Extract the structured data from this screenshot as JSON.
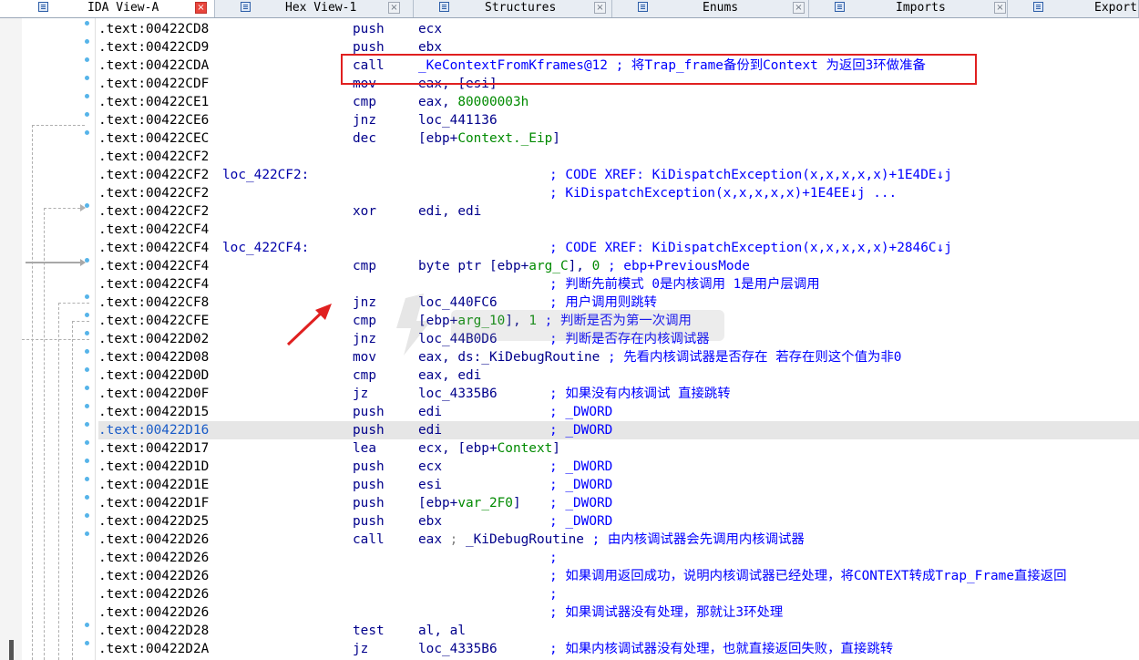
{
  "tabs": [
    {
      "label": "IDA View-A",
      "active": true,
      "icon": "listing-icon"
    },
    {
      "label": "Hex View-1",
      "active": false,
      "icon": "hex-icon"
    },
    {
      "label": "Structures",
      "active": false,
      "icon": "structures-icon"
    },
    {
      "label": "Enums",
      "active": false,
      "icon": "enums-icon"
    },
    {
      "label": "Imports",
      "active": false,
      "icon": "imports-icon"
    },
    {
      "label": "Export",
      "active": false,
      "icon": "exports-icon"
    }
  ],
  "close_glyph": "×",
  "rows": [
    {
      "addr": ".text:00422CD8",
      "label": "",
      "mnem": "push",
      "op": [
        {
          "t": "ecx"
        }
      ],
      "cmt": []
    },
    {
      "addr": ".text:00422CD9",
      "label": "",
      "mnem": "push",
      "op": [
        {
          "t": "ebx"
        }
      ],
      "cmt": []
    },
    {
      "addr": ".text:00422CDA",
      "label": "",
      "mnem": "call",
      "op": [
        {
          "t": "_KeContextFromKframes@12 ",
          "c": "cmt"
        },
        {
          "t": "; 将Trap_frame备份到Context 为返回3环做准备",
          "c": "cmt"
        }
      ],
      "cmt": []
    },
    {
      "addr": ".text:00422CDF",
      "label": "",
      "mnem": "mov",
      "op": [
        {
          "t": "eax, [esi]"
        }
      ],
      "cmt": []
    },
    {
      "addr": ".text:00422CE1",
      "label": "",
      "mnem": "cmp",
      "op": [
        {
          "t": "eax, "
        },
        {
          "t": "80000003h",
          "c": "num"
        }
      ],
      "cmt": []
    },
    {
      "addr": ".text:00422CE6",
      "label": "",
      "mnem": "jnz",
      "op": [
        {
          "t": "loc_441136"
        }
      ],
      "cmt": []
    },
    {
      "addr": ".text:00422CEC",
      "label": "",
      "mnem": "dec",
      "op": [
        {
          "t": "[ebp+"
        },
        {
          "t": "Context._Eip",
          "c": "grn"
        },
        {
          "t": "]"
        }
      ],
      "cmt": []
    },
    {
      "addr": ".text:00422CF2",
      "label": "",
      "mnem": "",
      "op": [],
      "cmt": []
    },
    {
      "addr": ".text:00422CF2",
      "label": "loc_422CF2:",
      "mnem": "",
      "op": [],
      "cmt": [
        {
          "t": "; CODE XREF: KiDispatchException(x,x,x,x,x)+1E4DE↓j"
        }
      ]
    },
    {
      "addr": ".text:00422CF2",
      "label": "",
      "mnem": "",
      "op": [],
      "cmt": [
        {
          "t": "; KiDispatchException(x,x,x,x,x)+1E4EE↓j ..."
        }
      ]
    },
    {
      "addr": ".text:00422CF2",
      "label": "",
      "mnem": "xor",
      "op": [
        {
          "t": "edi, edi"
        }
      ],
      "cmt": []
    },
    {
      "addr": ".text:00422CF4",
      "label": "",
      "mnem": "",
      "op": [],
      "cmt": []
    },
    {
      "addr": ".text:00422CF4",
      "label": "loc_422CF4:",
      "mnem": "",
      "op": [],
      "cmt": [
        {
          "t": "; CODE XREF: KiDispatchException(x,x,x,x,x)+2846C↓j"
        }
      ]
    },
    {
      "addr": ".text:00422CF4",
      "label": "",
      "mnem": "cmp",
      "op": [
        {
          "t": "byte ptr [ebp+"
        },
        {
          "t": "arg_C",
          "c": "grn"
        },
        {
          "t": "], "
        },
        {
          "t": "0",
          "c": "num"
        },
        {
          "t": " "
        },
        {
          "t": "; ebp+PreviousMode",
          "c": "cmt"
        }
      ],
      "cmt": []
    },
    {
      "addr": ".text:00422CF4",
      "label": "",
      "mnem": "",
      "op": [],
      "cmt": [
        {
          "t": "; 判断先前模式 0是内核调用 1是用户层调用"
        }
      ]
    },
    {
      "addr": ".text:00422CF8",
      "label": "",
      "mnem": "jnz",
      "op": [
        {
          "t": "loc_440FC6"
        }
      ],
      "cmt": [
        {
          "t": "; 用户调用则跳转"
        }
      ]
    },
    {
      "addr": ".text:00422CFE",
      "label": "",
      "mnem": "cmp",
      "op": [
        {
          "t": "[ebp+"
        },
        {
          "t": "arg_10",
          "c": "grn"
        },
        {
          "t": "], "
        },
        {
          "t": "1",
          "c": "num"
        },
        {
          "t": " "
        },
        {
          "t": "; 判断是否为第一次调用",
          "c": "cmt"
        }
      ],
      "cmt": []
    },
    {
      "addr": ".text:00422D02",
      "label": "",
      "mnem": "jnz",
      "op": [
        {
          "t": "loc_44B0D6"
        }
      ],
      "cmt": [
        {
          "t": "; 判断是否存在内核调试器"
        }
      ]
    },
    {
      "addr": ".text:00422D08",
      "label": "",
      "mnem": "mov",
      "op": [
        {
          "t": "eax, ds:_KiDebugRoutine "
        },
        {
          "t": "; 先看内核调试器是否存在 若存在则这个值为非0",
          "c": "cmt"
        }
      ],
      "cmt": []
    },
    {
      "addr": ".text:00422D0D",
      "label": "",
      "mnem": "cmp",
      "op": [
        {
          "t": "eax, edi"
        }
      ],
      "cmt": []
    },
    {
      "addr": ".text:00422D0F",
      "label": "",
      "mnem": "jz",
      "op": [
        {
          "t": "loc_4335B6"
        }
      ],
      "cmt": [
        {
          "t": "; 如果没有内核调试 直接跳转"
        }
      ]
    },
    {
      "addr": ".text:00422D15",
      "label": "",
      "mnem": "push",
      "op": [
        {
          "t": "edi"
        }
      ],
      "cmt": [
        {
          "t": "; _DWORD"
        }
      ]
    },
    {
      "addr": ".text:00422D16",
      "label": "",
      "mnem": "push",
      "op": [
        {
          "t": "edi"
        }
      ],
      "cmt": [
        {
          "t": "; _DWORD"
        }
      ],
      "hl": true
    },
    {
      "addr": ".text:00422D17",
      "label": "",
      "mnem": "lea",
      "op": [
        {
          "t": "ecx, [ebp+"
        },
        {
          "t": "Context",
          "c": "grn"
        },
        {
          "t": "]"
        }
      ],
      "cmt": []
    },
    {
      "addr": ".text:00422D1D",
      "label": "",
      "mnem": "push",
      "op": [
        {
          "t": "ecx"
        }
      ],
      "cmt": [
        {
          "t": "; _DWORD"
        }
      ]
    },
    {
      "addr": ".text:00422D1E",
      "label": "",
      "mnem": "push",
      "op": [
        {
          "t": "esi"
        }
      ],
      "cmt": [
        {
          "t": "; _DWORD"
        }
      ]
    },
    {
      "addr": ".text:00422D1F",
      "label": "",
      "mnem": "push",
      "op": [
        {
          "t": "[ebp+"
        },
        {
          "t": "var_2F0",
          "c": "grn"
        },
        {
          "t": "]"
        }
      ],
      "cmt": [
        {
          "t": "; _DWORD"
        }
      ]
    },
    {
      "addr": ".text:00422D25",
      "label": "",
      "mnem": "push",
      "op": [
        {
          "t": "ebx"
        }
      ],
      "cmt": [
        {
          "t": "; _DWORD"
        }
      ]
    },
    {
      "addr": ".text:00422D26",
      "label": "",
      "mnem": "call",
      "op": [
        {
          "t": "eax "
        },
        {
          "t": "; ",
          "c": "gray"
        },
        {
          "t": "_KiDebugRoutine ",
          "c": "blk"
        },
        {
          "t": "; 由内核调试器会先调用内核调试器",
          "c": "cmt"
        }
      ],
      "cmt": []
    },
    {
      "addr": ".text:00422D26",
      "label": "",
      "mnem": "",
      "op": [],
      "cmt": [
        {
          "t": ";"
        }
      ]
    },
    {
      "addr": ".text:00422D26",
      "label": "",
      "mnem": "",
      "op": [],
      "cmt": [
        {
          "t": "; 如果调用返回成功，说明内核调试器已经处理，将CONTEXT转成Trap_Frame直接返回"
        }
      ]
    },
    {
      "addr": ".text:00422D26",
      "label": "",
      "mnem": "",
      "op": [],
      "cmt": [
        {
          "t": ";"
        }
      ]
    },
    {
      "addr": ".text:00422D26",
      "label": "",
      "mnem": "",
      "op": [],
      "cmt": [
        {
          "t": "; 如果调试器没有处理，那就让3环处理"
        }
      ]
    },
    {
      "addr": ".text:00422D28",
      "label": "",
      "mnem": "test",
      "op": [
        {
          "t": "al, al"
        }
      ],
      "cmt": []
    },
    {
      "addr": ".text:00422D2A",
      "label": "",
      "mnem": "jz",
      "op": [
        {
          "t": "loc_4335B6"
        }
      ],
      "cmt": [
        {
          "t": "; 如果内核调试器没有处理，也就直接返回失败，直接跳转"
        }
      ]
    }
  ],
  "colors": {
    "address": "#000000",
    "instruction": "#00008b",
    "comment": "#0000ff",
    "number": "#008a00",
    "highlight_row": "#e6e6e6",
    "annotation_red": "#e02020"
  }
}
